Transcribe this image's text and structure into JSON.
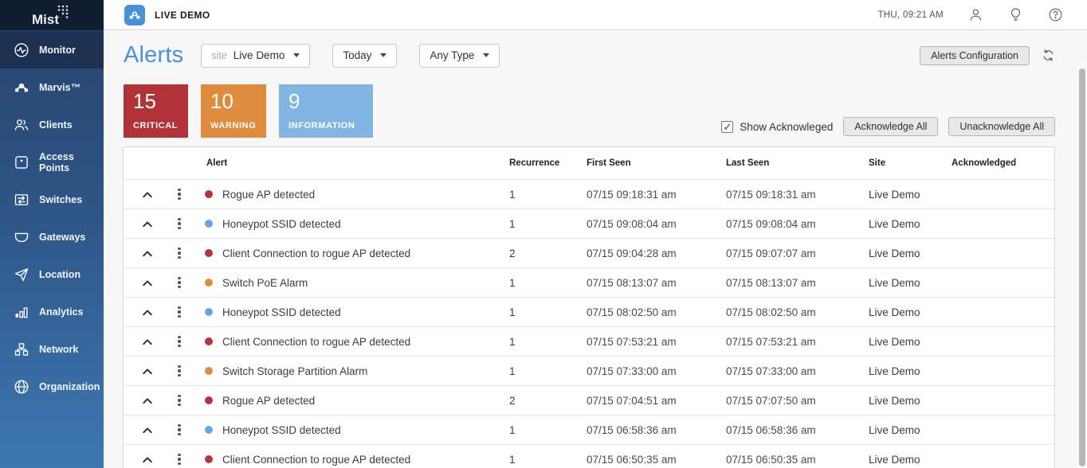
{
  "brand": {
    "logo_text": "Mist"
  },
  "topbar": {
    "org_label": "LIVE DEMO",
    "clock": "THU, 09:21 AM",
    "icons": [
      "user-icon",
      "lightbulb-icon",
      "help-icon"
    ]
  },
  "sidebar": {
    "items": [
      {
        "id": "monitor",
        "label": "Monitor",
        "icon": "activity-icon",
        "active": true
      },
      {
        "id": "marvis",
        "label": "Marvis™",
        "icon": "topology-icon",
        "active": false
      },
      {
        "id": "clients",
        "label": "Clients",
        "icon": "people-icon",
        "active": false
      },
      {
        "id": "access-points",
        "label": "Access Points",
        "icon": "access-point-icon",
        "active": false
      },
      {
        "id": "switches",
        "label": "Switches",
        "icon": "switch-icon",
        "active": false
      },
      {
        "id": "gateways",
        "label": "Gateways",
        "icon": "gateway-icon",
        "active": false
      },
      {
        "id": "location",
        "label": "Location",
        "icon": "paper-plane-icon",
        "active": false
      },
      {
        "id": "analytics",
        "label": "Analytics",
        "icon": "bar-chart-icon",
        "active": false
      },
      {
        "id": "network",
        "label": "Network",
        "icon": "sitemap-icon",
        "active": false
      },
      {
        "id": "organization",
        "label": "Organization",
        "icon": "globe-icon",
        "active": false
      }
    ]
  },
  "page": {
    "title": "Alerts",
    "filters": {
      "site_prefix": "site",
      "site_value": "Live Demo",
      "range_value": "Today",
      "type_value": "Any Type"
    },
    "config_button": "Alerts Configuration",
    "stats": [
      {
        "count": "15",
        "label": "CRITICAL",
        "color": "#b13338"
      },
      {
        "count": "10",
        "label": "WARNING",
        "color": "#df8b3e"
      },
      {
        "count": "9",
        "label": "INFORMATION",
        "color": "#82b5e3"
      }
    ],
    "ack": {
      "checkbox_label": "Show Acknowleged",
      "checkbox_checked": true,
      "check_glyph": "✓",
      "ack_all_button": "Acknowledge All",
      "unack_all_button": "Unacknowledge All"
    }
  },
  "severity_colors": {
    "critical": "#b8333b",
    "warning": "#df8b3e",
    "info": "#69a5de"
  },
  "table": {
    "columns": {
      "alert": "Alert",
      "recurrence": "Recurrence",
      "first_seen": "First Seen",
      "last_seen": "Last Seen",
      "site": "Site",
      "acknowledged": "Acknowledged"
    },
    "rows": [
      {
        "severity": "critical",
        "alert": "Rogue AP detected",
        "recurrence": "1",
        "first_seen": "07/15 09:18:31 am",
        "last_seen": "07/15 09:18:31 am",
        "site": "Live Demo",
        "acknowledged": ""
      },
      {
        "severity": "info",
        "alert": "Honeypot SSID detected",
        "recurrence": "1",
        "first_seen": "07/15 09:08:04 am",
        "last_seen": "07/15 09:08:04 am",
        "site": "Live Demo",
        "acknowledged": ""
      },
      {
        "severity": "critical",
        "alert": "Client Connection to rogue AP detected",
        "recurrence": "2",
        "first_seen": "07/15 09:04:28 am",
        "last_seen": "07/15 09:07:07 am",
        "site": "Live Demo",
        "acknowledged": ""
      },
      {
        "severity": "warning",
        "alert": "Switch PoE Alarm",
        "recurrence": "1",
        "first_seen": "07/15 08:13:07 am",
        "last_seen": "07/15 08:13:07 am",
        "site": "Live Demo",
        "acknowledged": ""
      },
      {
        "severity": "info",
        "alert": "Honeypot SSID detected",
        "recurrence": "1",
        "first_seen": "07/15 08:02:50 am",
        "last_seen": "07/15 08:02:50 am",
        "site": "Live Demo",
        "acknowledged": ""
      },
      {
        "severity": "critical",
        "alert": "Client Connection to rogue AP detected",
        "recurrence": "1",
        "first_seen": "07/15 07:53:21 am",
        "last_seen": "07/15 07:53:21 am",
        "site": "Live Demo",
        "acknowledged": ""
      },
      {
        "severity": "warning",
        "alert": "Switch Storage Partition Alarm",
        "recurrence": "1",
        "first_seen": "07/15 07:33:00 am",
        "last_seen": "07/15 07:33:00 am",
        "site": "Live Demo",
        "acknowledged": ""
      },
      {
        "severity": "critical",
        "alert": "Rogue AP detected",
        "recurrence": "2",
        "first_seen": "07/15 07:04:51 am",
        "last_seen": "07/15 07:07:50 am",
        "site": "Live Demo",
        "acknowledged": ""
      },
      {
        "severity": "info",
        "alert": "Honeypot SSID detected",
        "recurrence": "1",
        "first_seen": "07/15 06:58:36 am",
        "last_seen": "07/15 06:58:36 am",
        "site": "Live Demo",
        "acknowledged": ""
      },
      {
        "severity": "critical",
        "alert": "Client Connection to rogue AP detected",
        "recurrence": "1",
        "first_seen": "07/15 06:50:35 am",
        "last_seen": "07/15 06:50:35 am",
        "site": "Live Demo",
        "acknowledged": ""
      }
    ]
  }
}
